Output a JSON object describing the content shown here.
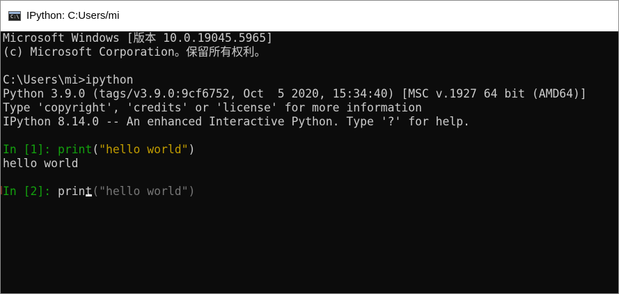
{
  "window": {
    "title": "IPython: C:Users/mi",
    "icon": "terminal-icon",
    "icon_glyph": "C:\\"
  },
  "console": {
    "lines": [
      "Microsoft Windows [版本 10.0.19045.5965]",
      "(c) Microsoft Corporation。保留所有权利。",
      "",
      "C:\\Users\\mi>ipython",
      "Python 3.9.0 (tags/v3.9.0:9cf6752, Oct  5 2020, 15:34:40) [MSC v.1927 64 bit (AMD64)]",
      "Type 'copyright', 'credits' or 'license' for more information",
      "IPython 8.14.0 -- An enhanced Interactive Python. Type '?' for help."
    ],
    "cell1": {
      "prompt": "In [1]: ",
      "func": "print",
      "open": "(",
      "str": "\"hello world\"",
      "close": ")",
      "output": "hello world"
    },
    "cell2": {
      "prompt": "In [2]: ",
      "typed": "print",
      "suggestion": "(\"hello world\")"
    }
  },
  "colors": {
    "background": "#0c0c0c",
    "text": "#cccccc",
    "prompt_green": "#13a10e",
    "string_yellow": "#c19c00",
    "suggestion_gray": "#767676"
  }
}
